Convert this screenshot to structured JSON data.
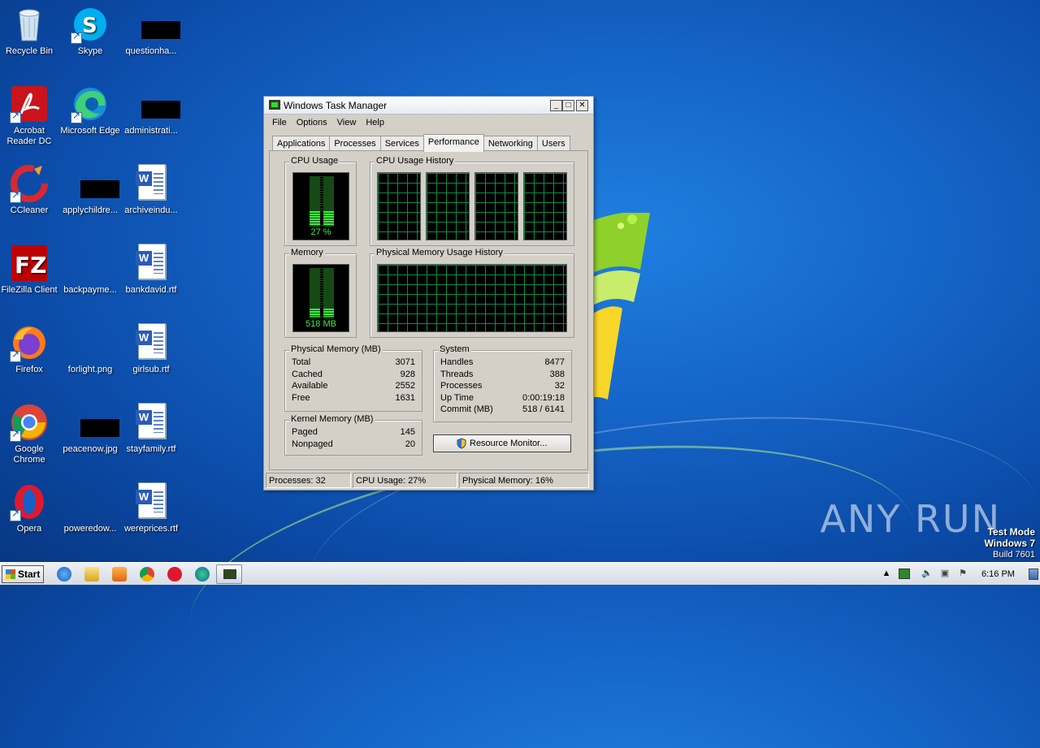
{
  "desktop": {
    "icons": [
      {
        "label": "Recycle Bin"
      },
      {
        "label": "Skype"
      },
      {
        "label": "questionha..."
      },
      {
        "label": "Acrobat Reader DC"
      },
      {
        "label": "Microsoft Edge"
      },
      {
        "label": "administrati..."
      },
      {
        "label": "CCleaner"
      },
      {
        "label": "applychildre..."
      },
      {
        "label": "archiveindu..."
      },
      {
        "label": "FileZilla Client"
      },
      {
        "label": "backpayme..."
      },
      {
        "label": "bankdavid.rtf"
      },
      {
        "label": "Firefox"
      },
      {
        "label": "forlight.png"
      },
      {
        "label": "girlsub.rtf"
      },
      {
        "label": "Google Chrome"
      },
      {
        "label": "peacenow.jpg"
      },
      {
        "label": "stayfamily.rtf"
      },
      {
        "label": "Opera"
      },
      {
        "label": "poweredow..."
      },
      {
        "label": "wereprices.rtf"
      }
    ],
    "watermark": "ANY RUN",
    "test_mode": {
      "line1": "Test Mode",
      "line2": "Windows 7",
      "line3": "Build 7601"
    }
  },
  "task_manager": {
    "title": "Windows Task Manager",
    "buttons": {
      "minimize": "_",
      "maximize": "□",
      "close": "✕"
    },
    "menu": [
      "File",
      "Options",
      "View",
      "Help"
    ],
    "tabs": [
      "Applications",
      "Processes",
      "Services",
      "Performance",
      "Networking",
      "Users"
    ],
    "active_tab": "Performance",
    "cpu_usage": {
      "title": "CPU Usage",
      "value": "27 %",
      "percent": 27
    },
    "cpu_history": {
      "title": "CPU Usage History",
      "cores": 4
    },
    "memory": {
      "title": "Memory",
      "value": "518 MB",
      "percent": 16
    },
    "memory_history": {
      "title": "Physical Memory Usage History"
    },
    "physical_memory": {
      "title": "Physical Memory (MB)",
      "rows": [
        {
          "label": "Total",
          "value": "3071"
        },
        {
          "label": "Cached",
          "value": "928"
        },
        {
          "label": "Available",
          "value": "2552"
        },
        {
          "label": "Free",
          "value": "1631"
        }
      ]
    },
    "kernel_memory": {
      "title": "Kernel Memory (MB)",
      "rows": [
        {
          "label": "Paged",
          "value": "145"
        },
        {
          "label": "Nonpaged",
          "value": "20"
        }
      ]
    },
    "system": {
      "title": "System",
      "rows": [
        {
          "label": "Handles",
          "value": "8477"
        },
        {
          "label": "Threads",
          "value": "388"
        },
        {
          "label": "Processes",
          "value": "32"
        },
        {
          "label": "Up Time",
          "value": "0:00:19:18"
        },
        {
          "label": "Commit (MB)",
          "value": "518 / 6141"
        }
      ]
    },
    "resource_monitor_button": "Resource Monitor...",
    "status": {
      "processes": "Processes: 32",
      "cpu": "CPU Usage: 27%",
      "memory": "Physical Memory: 16%"
    }
  },
  "taskbar": {
    "start_label": "Start",
    "clock": "6:16 PM"
  }
}
